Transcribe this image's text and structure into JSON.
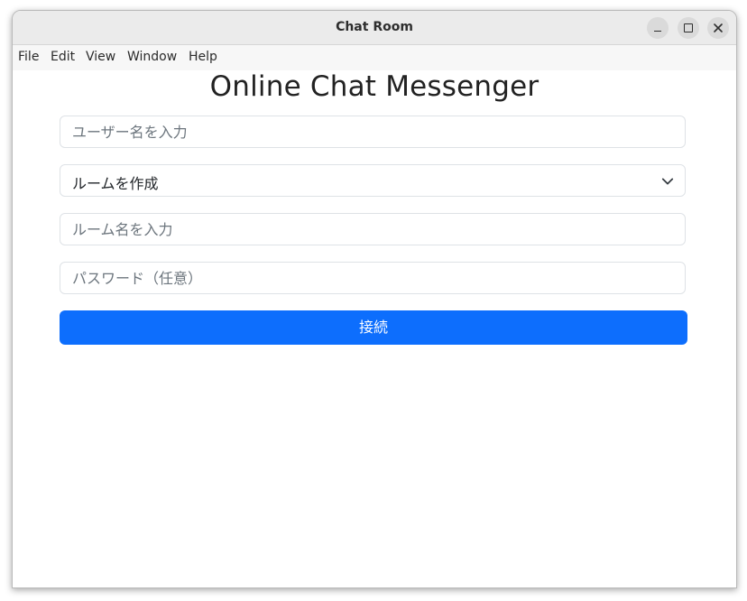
{
  "window": {
    "title": "Chat Room",
    "controls": {
      "minimize": "minimize-icon",
      "maximize": "maximize-icon",
      "close": "close-icon"
    }
  },
  "menubar": {
    "items": [
      "File",
      "Edit",
      "View",
      "Window",
      "Help"
    ]
  },
  "form": {
    "heading": "Online Chat Messenger",
    "username": {
      "value": "",
      "placeholder": "ユーザー名を入力"
    },
    "room_action": {
      "selected": "ルームを作成"
    },
    "room_name": {
      "value": "",
      "placeholder": "ルーム名を入力"
    },
    "password": {
      "value": "",
      "placeholder": "パスワード（任意）"
    },
    "connect_label": "接続"
  },
  "colors": {
    "primary": "#0d6efd",
    "titlebar": "#ebebeb",
    "menubar": "#f7f7f7",
    "border": "#dee2e6"
  }
}
